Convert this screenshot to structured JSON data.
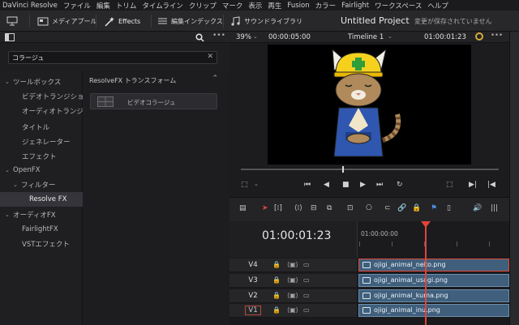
{
  "menubar": [
    "DaVinci Resolve",
    "ファイル",
    "編集",
    "トリム",
    "タイムライン",
    "クリップ",
    "マーク",
    "表示",
    "再生",
    "Fusion",
    "カラー",
    "Fairlight",
    "ワークスペース",
    "ヘルプ"
  ],
  "toolbar": {
    "media_pool": "メディアプール",
    "effects": "Effects",
    "edit_index": "編集インデックス",
    "sound_library": "サウンドライブラリ",
    "project_title": "Untitled Project",
    "save_status": "変更が保存されていません"
  },
  "viewer": {
    "zoom": "39%",
    "source_tc": "00:00:05:00",
    "timeline_name": "Timeline 1",
    "record_tc": "01:00:01:23"
  },
  "effects_panel": {
    "search_value": "コラージュ",
    "category_header": "ResolveFX トランスフォーム",
    "tile_label": "ビデオコラージュ",
    "tree": [
      {
        "label": "ツールボックス",
        "level": 0,
        "expanded": true
      },
      {
        "label": "ビデオトランジション",
        "level": 1
      },
      {
        "label": "オーディオトランジシ...",
        "level": 1
      },
      {
        "label": "タイトル",
        "level": 1
      },
      {
        "label": "ジェネレーター",
        "level": 1
      },
      {
        "label": "エフェクト",
        "level": 1
      },
      {
        "label": "OpenFX",
        "level": 0,
        "expanded": true
      },
      {
        "label": "フィルター",
        "level": 1,
        "expanded": true
      },
      {
        "label": "Resolve FX",
        "level": 2,
        "selected": true
      },
      {
        "label": "オーディオFX",
        "level": 0,
        "expanded": true
      },
      {
        "label": "FairlightFX",
        "level": 1
      },
      {
        "label": "VSTエフェクト",
        "level": 1
      }
    ]
  },
  "timeline": {
    "timecode": "01:00:01:23",
    "ruler_label": "01:00:00:00",
    "tracks": [
      {
        "name": "V4",
        "clip": "ojigi_animal_neko.png",
        "selected": true
      },
      {
        "name": "V3",
        "clip": "ojigi_animal_usagi.png"
      },
      {
        "name": "V2",
        "clip": "ojigi_animal_kuma.png"
      },
      {
        "name": "V1",
        "clip": "ojigi_animal_inu.png",
        "boxed": true
      }
    ]
  },
  "colors": {
    "accent_red": "#e0443c",
    "clip_blue": "#3f5f7c",
    "selection_blue": "#4a8fe0"
  },
  "icons": [
    "monitor-icon",
    "media-pool-icon",
    "effects-wand-icon",
    "edit-index-icon",
    "sound-library-icon",
    "search-icon",
    "more-icon",
    "stop-icon",
    "play-icon",
    "loop-icon",
    "snap-icon",
    "link-icon",
    "lock-icon",
    "flag-icon",
    "volume-icon"
  ]
}
